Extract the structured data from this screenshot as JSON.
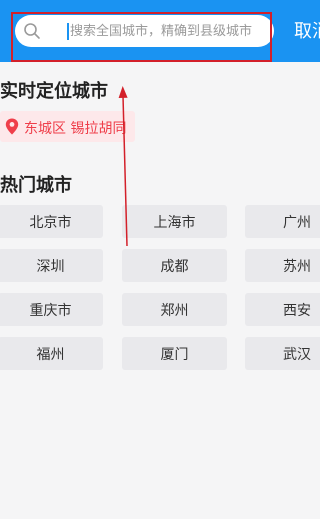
{
  "search": {
    "placeholder": "搜索全国城市，精确到县级城市",
    "cancel_label": "取消"
  },
  "location": {
    "section_title": "实时定位城市",
    "current_label": "东城区 锡拉胡同"
  },
  "hot_cities": {
    "section_title": "热门城市",
    "items": [
      "北京市",
      "上海市",
      "广州",
      "深圳",
      "成都",
      "苏州",
      "重庆市",
      "郑州",
      "西安",
      "福州",
      "厦门",
      "武汉"
    ]
  },
  "colors": {
    "header": "#1a93f2",
    "annotation": "#d3202a",
    "location_text": "#ef3e4a"
  }
}
